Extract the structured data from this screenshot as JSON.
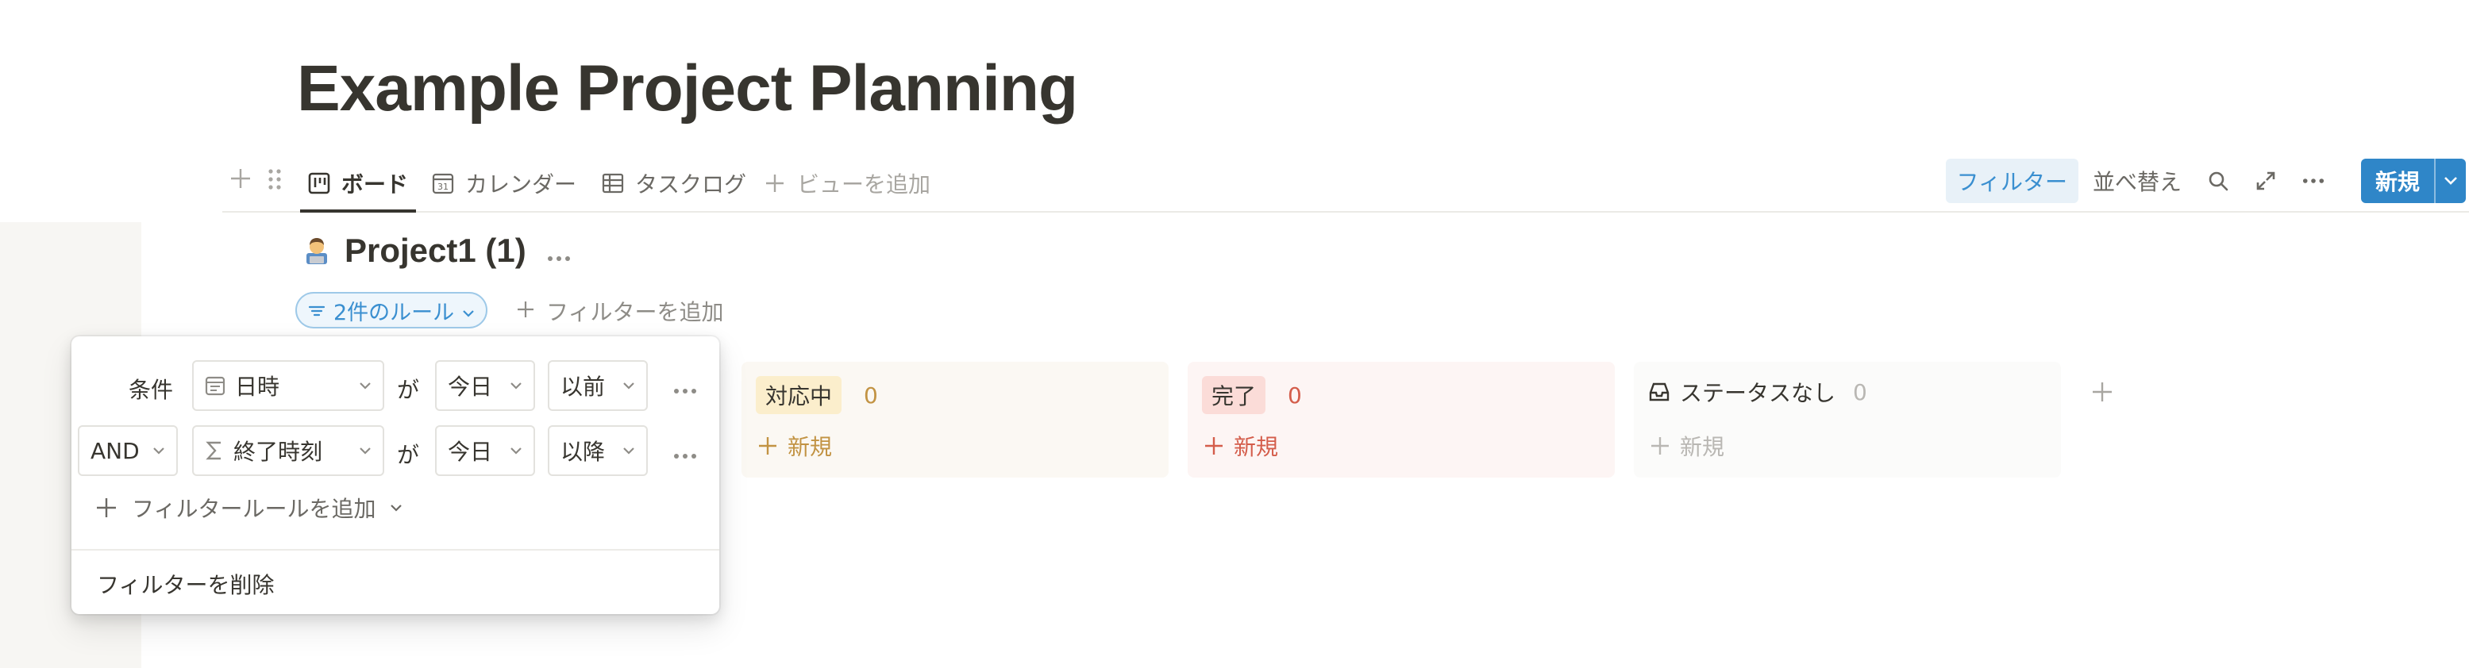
{
  "page": {
    "title": "Example Project Planning"
  },
  "tabs": [
    {
      "label": "ボード",
      "icon": "board-icon",
      "active": true
    },
    {
      "label": "カレンダー",
      "icon": "calendar-icon",
      "active": false
    },
    {
      "label": "タスクログ",
      "icon": "table-icon",
      "active": false
    },
    {
      "label": "ビューを追加",
      "icon": "plus-icon",
      "active": false
    }
  ],
  "calendar_icon_day": "31",
  "toolbar": {
    "filter_label": "フィルター",
    "sort_label": "並べ替え",
    "new_label": "新規"
  },
  "group": {
    "emoji": "technologist-emoji",
    "title": "Project1 (1)"
  },
  "filter_bar": {
    "rules_label": "2件のルール",
    "add_filter_label": "フィルターを追加"
  },
  "columns": [
    {
      "label": "対応中",
      "count": "0",
      "tag_bg": "#fbeecc",
      "count_color": "#c29343",
      "new_label": "新規",
      "new_color": "#c29343",
      "bg": "#fbf8f3"
    },
    {
      "label": "完了",
      "count": "0",
      "tag_bg": "#fbdcd8",
      "count_color": "#d45d4b",
      "new_label": "新規",
      "new_color": "#d45d4b",
      "bg": "#fdf5f4"
    },
    {
      "label": "ステータスなし",
      "count": "0",
      "tag_bg": "transparent",
      "count_color": "#b9b7b3",
      "new_label": "新規",
      "new_color": "#b9b7b3",
      "bg": "#fbfbfa"
    }
  ],
  "filter_popover": {
    "rows": [
      {
        "prefix": "条件",
        "property": "日時",
        "property_icon": "date-property-icon",
        "connector": "が",
        "value": "今日",
        "operator": "以前"
      },
      {
        "prefix": "AND",
        "property": "終了時刻",
        "property_icon": "formula-sigma-icon",
        "connector": "が",
        "value": "今日",
        "operator": "以降"
      }
    ],
    "add_rule_label": "フィルタールールを追加",
    "delete_label": "フィルターを削除"
  },
  "colors": {
    "accent_blue": "#2f86c8",
    "filter_active_bg": "#e8f1f8",
    "sidebar_bg": "#f7f6f3"
  }
}
